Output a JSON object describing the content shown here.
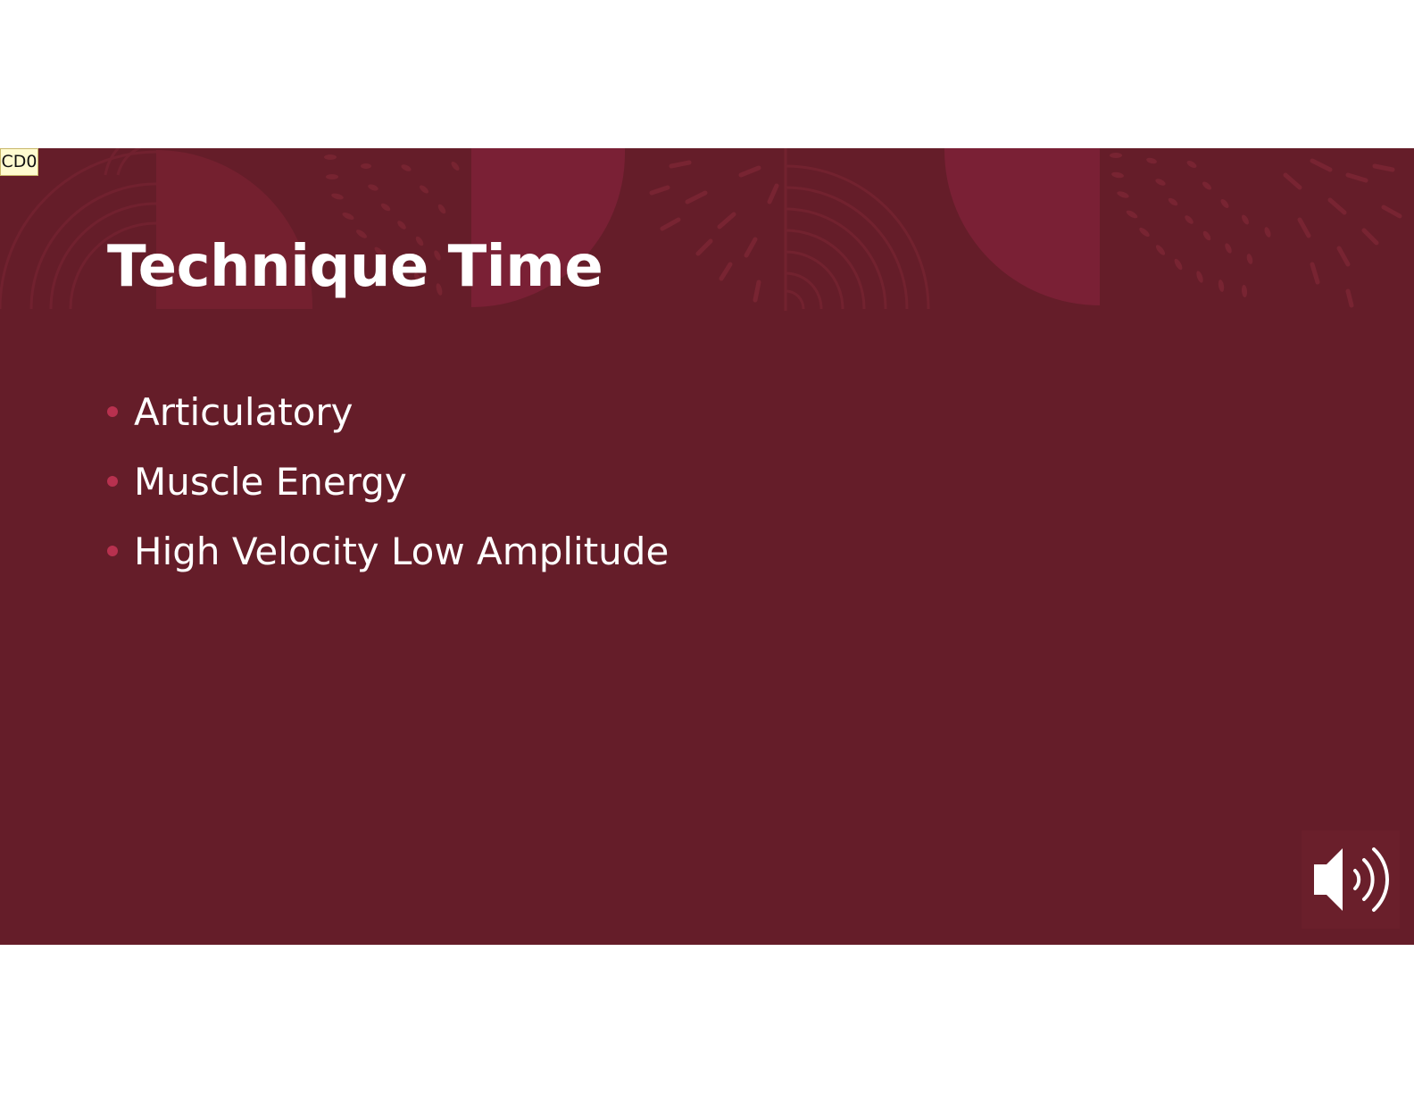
{
  "tag": {
    "label": "CD0"
  },
  "slide": {
    "title": "Technique Time",
    "bullets": [
      {
        "text": "Articulatory"
      },
      {
        "text": "Muscle Energy"
      },
      {
        "text": "High Velocity Low Amplitude"
      }
    ],
    "audio_icon": "speaker-volume-icon"
  },
  "colors": {
    "background": "#651d29",
    "banner_accent": "#7a2035",
    "bullet_accent": "#b8314f",
    "text": "#ffffff"
  }
}
